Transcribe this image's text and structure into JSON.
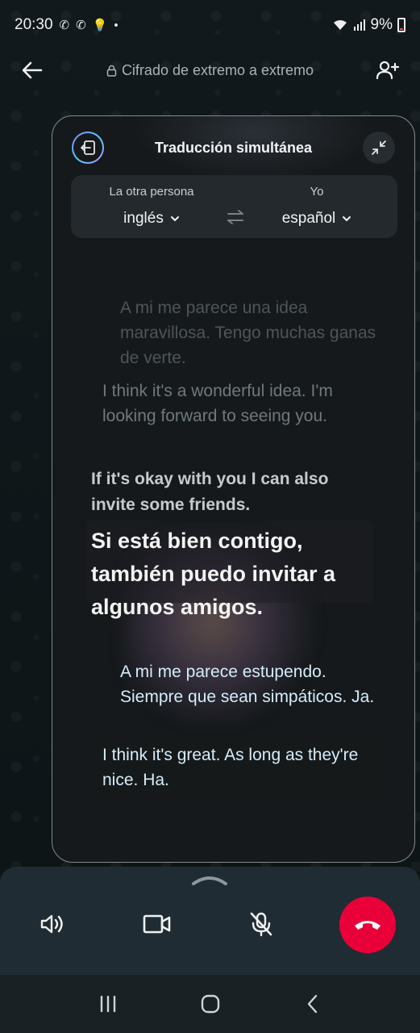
{
  "status_bar": {
    "time": "20:30",
    "battery": "9%"
  },
  "header": {
    "encryption_label": "Cifrado de extremo a extremo",
    "icons": [
      "back-arrow-icon",
      "lock-icon",
      "add-person-icon"
    ]
  },
  "translation_panel": {
    "title": "Traducción simultánea",
    "left_language": {
      "caption": "La otra persona",
      "selected": "inglés"
    },
    "right_language": {
      "caption": "Yo",
      "selected": "español"
    },
    "messages": [
      {
        "text": "A mi me parece una idea maravillosa. Tengo muchas ganas de verte."
      },
      {
        "text": "I think it's a wonderful idea. I'm looking forward to seeing you."
      },
      {
        "text": "If it's okay with you I can also invite some friends."
      },
      {
        "text": "Si está bien contigo, también puedo invitar a algunos amigos."
      },
      {
        "text": "A mi me parece estupendo. Siempre que sean simpáticos. Ja."
      },
      {
        "text": "I think it's great. As long as they're nice. Ha."
      }
    ]
  },
  "controls": {
    "icons": [
      "speaker-icon",
      "video-icon",
      "mic-off-icon",
      "end-call-icon"
    ],
    "end_call_color": "#ea0038"
  },
  "colors": {
    "background": "#0e1416",
    "panel": "#15191b",
    "controls": "#202c33",
    "translated_text": "#d6ecfb"
  }
}
